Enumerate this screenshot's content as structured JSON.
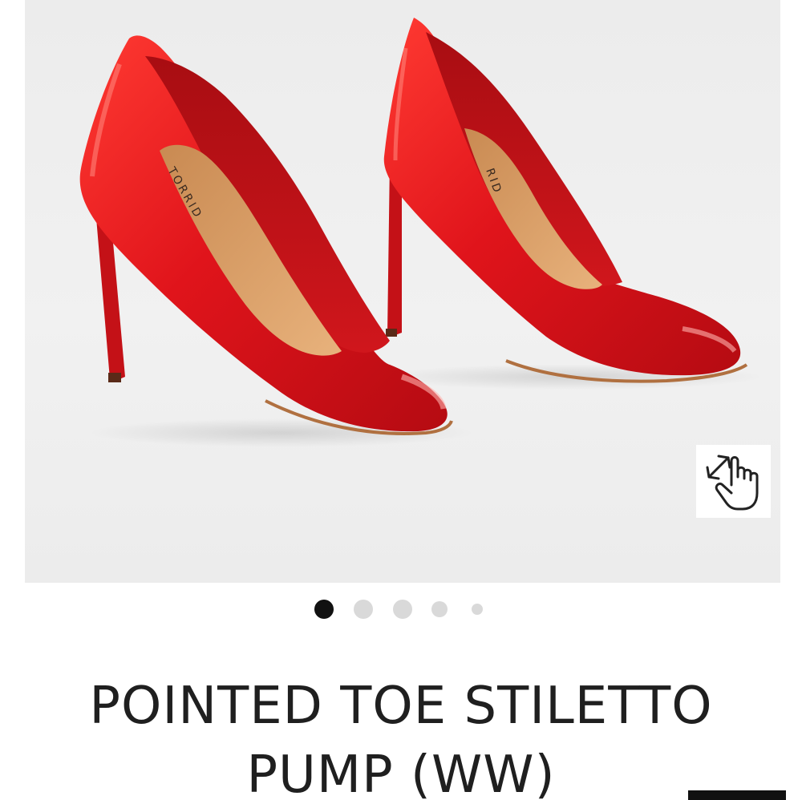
{
  "product": {
    "image_alt": "Red patent pointed toe stiletto pumps",
    "insole_brand_text": "TORRID",
    "title": "POINTED TOE STILETTO PUMP (WW)",
    "title_line1": "POINTED TOE STILETTO",
    "title_line2": "PUMP (WW)"
  },
  "zoom": {
    "icon": "pinch-zoom-hand-icon",
    "aria_label": "Zoom image"
  },
  "carousel": {
    "total_slides": 5,
    "active_index": 0
  },
  "colors": {
    "shoe_red": "#e0141b",
    "insole_tan": "#d9a066",
    "background_grey": "#efefef",
    "dot_active": "#111111",
    "dot_inactive": "#d9d9d9",
    "title_text": "#1f1f1f"
  }
}
